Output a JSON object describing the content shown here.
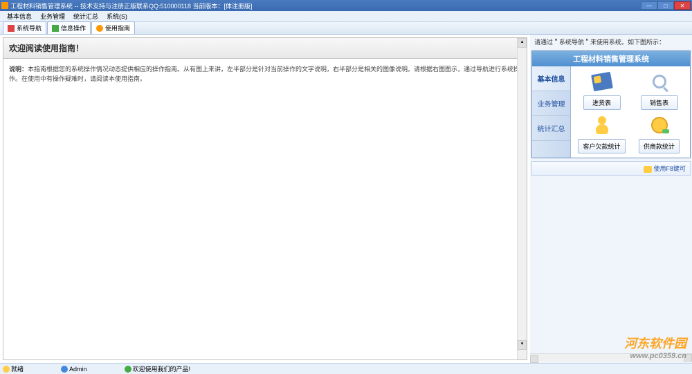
{
  "titlebar": {
    "title": "工程材料销售管理系统 -- 技术支持与注册正版联系QQ:510000118    当前版本：[体注册版]"
  },
  "menubar": {
    "items": [
      "基本信息",
      "业务管理",
      "统计汇总",
      "系统(S)"
    ]
  },
  "tabs": [
    {
      "label": "系统导航"
    },
    {
      "label": "信息操作"
    },
    {
      "label": "使用指南"
    }
  ],
  "content": {
    "title": "欢迎阅读使用指南！",
    "desc_label": "说明：",
    "desc_text": "本指南根据您的系统操作情况动态提供相应的操作指南。从有图上来讲，左半部分是针对当前操作的文字说明，右半部分是相关的图像说明。请根据右图图示，通过导航进行系统操作。在使用中有操作疑难时，请阅读本使用指南。"
  },
  "sidebar": {
    "hint": "请通过＂系统导航＂来使用系统。如下图所示：",
    "panel_title": "工程材料销售管理系统",
    "tabs": [
      "基本信息",
      "业务管理",
      "统计汇总"
    ],
    "cards": [
      {
        "label": "进货表"
      },
      {
        "label": "销售表"
      },
      {
        "label": "客户欠款统计"
      },
      {
        "label": "供商款统计"
      }
    ],
    "footer": "使用F8键可"
  },
  "watermark": {
    "brand": "河东软件园",
    "url": "www.pc0359.cn"
  },
  "status": {
    "ready": "就绪",
    "user": "Admin",
    "welcome": "欢迎使用我们的产品!"
  }
}
